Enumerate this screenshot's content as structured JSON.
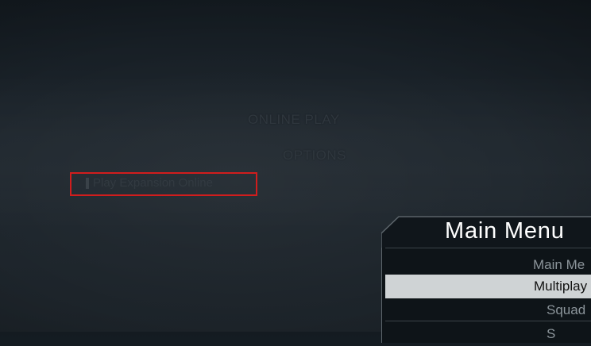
{
  "background_menu": {
    "online_play": "ONLINE PLAY",
    "options": "OPTIONS",
    "play_link": "Play Expansion Online"
  },
  "main_menu_panel": {
    "title": "Main Menu",
    "items": [
      {
        "label": "Main Me",
        "selected": false
      },
      {
        "label": "Multiplay",
        "selected": true
      },
      {
        "label": "Squad",
        "selected": false
      },
      {
        "label": "S",
        "selected": false
      }
    ]
  },
  "colors": {
    "highlight_box": "#d11d1d",
    "selected_item_bg": "#cfd3d5",
    "panel_bg": "#0e1418"
  }
}
